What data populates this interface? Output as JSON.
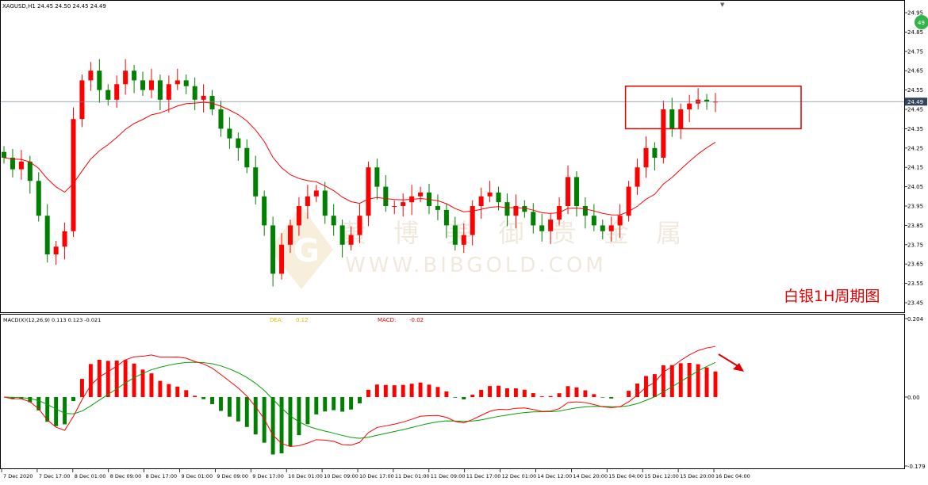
{
  "window": {
    "symbol_info": "XAGUSD,H1  24.45 24.50 24.45 24.49",
    "collapse_marker": "▼",
    "badge": "49"
  },
  "price_panel": {
    "annotation": "白银1H周期图",
    "current_price": "24.49",
    "watermark_cn": "黄 博 美 御 贵 金 属",
    "watermark_en": "WWW.BIBGOLD.COM",
    "watermark_logo": "G",
    "price_axis": [
      "24.95",
      "24.85",
      "24.75",
      "24.65",
      "24.55",
      "24.45",
      "24.35",
      "24.25",
      "24.15",
      "24.05",
      "23.95",
      "23.85",
      "23.75",
      "23.65",
      "23.55",
      "23.45"
    ]
  },
  "macd_panel": {
    "title": "MACD(X)(12,26,9) 0.113 0.123 -0.021",
    "dea_label": "DEA:",
    "dea_value": "0.12",
    "macd_label": "MACD:",
    "macd_value": "-0.02",
    "axis": [
      "0.204",
      "0.00",
      "-0.179"
    ]
  },
  "time_axis": [
    "7 Dec 2020",
    "7 Dec 17:00",
    "8 Dec 01:00",
    "8 Dec 09:00",
    "8 Dec 17:00",
    "9 Dec 01:00",
    "9 Dec 09:00",
    "9 Dec 17:00",
    "10 Dec 01:00",
    "10 Dec 09:00",
    "10 Dec 17:00",
    "11 Dec 01:00",
    "11 Dec 09:00",
    "11 Dec 17:00",
    "12 Dec 01:00",
    "14 Dec 12:00",
    "14 Dec 20:00",
    "15 Dec 04:00",
    "15 Dec 12:00",
    "15 Dec 20:00",
    "16 Dec 04:00"
  ],
  "colors": {
    "bull": "#ff0000",
    "bear": "#008000",
    "ma": "#ff0000",
    "signal": "#00a000",
    "annotation": "#e00000"
  },
  "chart_data": {
    "type": "candlestick",
    "symbol": "XAGUSD",
    "timeframe": "H1",
    "ylim": [
      23.45,
      24.95
    ],
    "closes": [
      24.2,
      24.14,
      24.18,
      24.08,
      23.9,
      23.7,
      23.74,
      23.82,
      24.4,
      24.6,
      24.65,
      24.55,
      24.5,
      24.58,
      24.65,
      24.6,
      24.55,
      24.6,
      24.5,
      24.58,
      24.6,
      24.57,
      24.5,
      24.52,
      24.45,
      24.35,
      24.3,
      24.25,
      24.15,
      24.0,
      23.85,
      23.6,
      23.75,
      23.85,
      23.95,
      24.0,
      24.03,
      23.9,
      23.85,
      23.75,
      23.8,
      23.9,
      24.15,
      24.05,
      23.95,
      23.95,
      23.97,
      24.0,
      24.02,
      23.95,
      23.93,
      23.85,
      23.75,
      23.8,
      23.95,
      24.0,
      24.02,
      23.97,
      23.9,
      23.95,
      23.92,
      23.85,
      23.82,
      23.88,
      23.95,
      24.1,
      23.95,
      23.9,
      23.85,
      23.82,
      23.85,
      23.9,
      24.05,
      24.15,
      24.25,
      24.2,
      24.45,
      24.35,
      24.45,
      24.48,
      24.5,
      24.49,
      24.49
    ],
    "ma_period_visible": true,
    "last_price": 24.49,
    "highlight_box": {
      "from_price": 24.35,
      "to_price": 24.57
    }
  }
}
